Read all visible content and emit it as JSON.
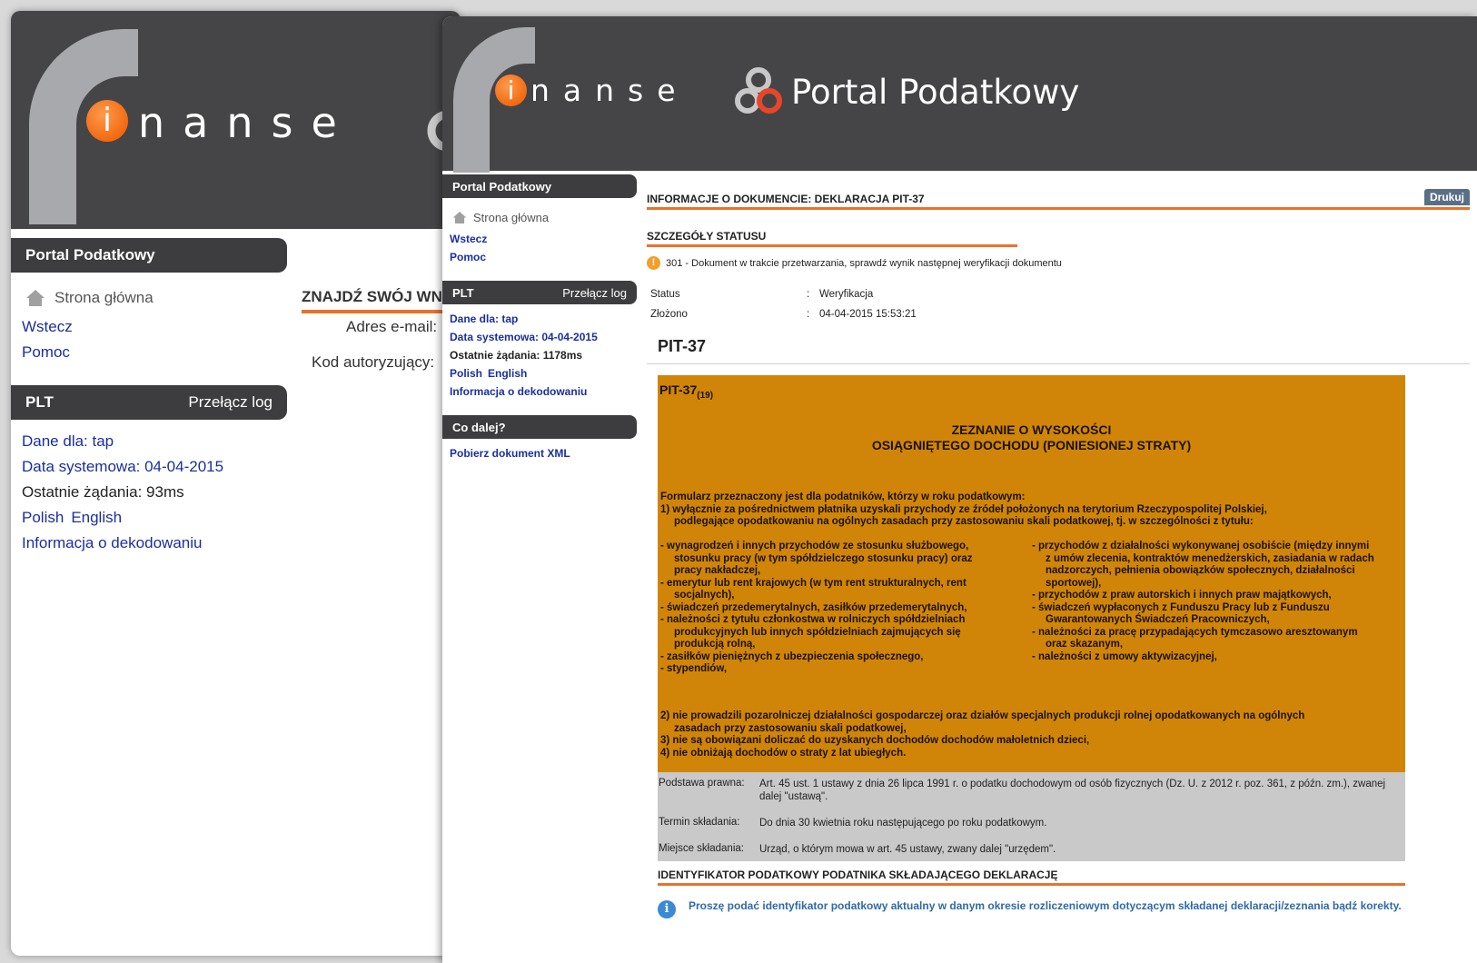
{
  "brand": {
    "logo_i": "i",
    "logo_text": "nanse",
    "portal_title": "Portal Podatkowy"
  },
  "back_window": {
    "sidebar_header": "Portal Podatkowy",
    "home": "Strona główna",
    "links": [
      "Wstecz",
      "Pomoc"
    ],
    "plt_header": "PLT",
    "plt_toggle": "Przełącz log",
    "data_for": "Dane dla: tap",
    "system_date": "Data systemowa: 04-04-2015",
    "last_request": "Ostatnie żądania: 93ms",
    "lang_polish": "Polish",
    "lang_english": "English",
    "decoding_info": "Informacja o dekodowaniu",
    "main_title": "ZNAJDŹ SWÓJ WNIOSEK",
    "email_label": "Adres e-mail:",
    "auth_code_label": "Kod autoryzujący:"
  },
  "sidebar": {
    "header": "Portal Podatkowy",
    "home": "Strona główna",
    "links": [
      "Wstecz",
      "Pomoc"
    ],
    "plt_header": "PLT",
    "plt_toggle": "Przełącz log",
    "data_for": "Dane dla: tap",
    "system_date": "Data systemowa: 04-04-2015",
    "last_request": "Ostatnie żądania: 1178ms",
    "lang_polish": "Polish",
    "lang_english": "English",
    "decoding_info": "Informacja o dekodowaniu",
    "next_header": "Co dalej?",
    "download_xml": "Pobierz dokument XML"
  },
  "document": {
    "info_title": "INFORMACJE O DOKUMENCIE: DEKLARACJA PIT-37",
    "print_label": "Drukuj",
    "status_details_title": "SZCZEGÓŁY STATUSU",
    "status_message": "301 - Dokument w trakcie przetwarzania, sprawdź wynik następnej weryfikacji dokumentu",
    "fields": [
      {
        "key": "Status",
        "sep": ":",
        "value": "Weryfikacja"
      },
      {
        "key": "Złożono",
        "sep": ":",
        "value": "04-04-2015 15:53:21"
      }
    ],
    "form_title": "PIT-37"
  },
  "form": {
    "code": "PIT-37",
    "version": "(19)",
    "title_line1": "ZEZNANIE O WYSOKOŚCI",
    "title_line2": "OSIĄGNIĘTEGO DOCHODU (PONIESIONEJ STRATY)",
    "intro_line1": "Formularz przeznaczony jest dla podatników, którzy w roku podatkowym:",
    "intro_line2": "1) wyłącznie za pośrednictwem płatnika uzyskali przychody ze źródeł położonych na terytorium Rzeczypospolitej Polskiej,",
    "intro_line3": "podlegające opodatkowaniu na ogólnych zasadach przy zastosowaniu skali podatkowej, tj. w szczególności z tytułu:",
    "left_items": [
      {
        "first": "- wynagrodzeń i innych przychodów ze stosunku służbowego,",
        "rest": [
          "stosunku pracy (w tym spółdzielczego stosunku pracy) oraz",
          "pracy nakładczej,"
        ]
      },
      {
        "first": "- emerytur lub rent krajowych (w tym rent strukturalnych, rent",
        "rest": [
          "socjalnych),"
        ]
      },
      {
        "first": "- świadczeń przedemerytalnych, zasiłków przedemerytalnych,",
        "rest": []
      },
      {
        "first": "- należności z tytułu członkostwa w rolniczych spółdzielniach",
        "rest": [
          "produkcyjnych lub innych spółdzielniach zajmujących się",
          "produkcją rolną,"
        ]
      },
      {
        "first": "- zasiłków pieniężnych z ubezpieczenia społecznego,",
        "rest": []
      },
      {
        "first": "- stypendiów,",
        "rest": []
      }
    ],
    "right_items": [
      {
        "first": "- przychodów z działalności wykonywanej osobiście (między innymi",
        "rest": [
          "z umów zlecenia, kontraktów menedżerskich, zasiadania w radach",
          "nadzorczych, pełnienia obowiązków społecznych, działalności",
          "sportowej),"
        ]
      },
      {
        "first": "- przychodów z praw autorskich i innych praw majątkowych,",
        "rest": []
      },
      {
        "first": "- świadczeń wypłaconych z Funduszu Pracy lub z Funduszu",
        "rest": [
          "Gwarantowanych Świadczeń Pracowniczych,"
        ]
      },
      {
        "first": "- należności za pracę przypadających tymczasowo aresztowanym",
        "rest": [
          "oraz skazanym,"
        ]
      },
      {
        "first": "- należności z umowy aktywizacyjnej,",
        "rest": []
      }
    ],
    "tail_line1": "2) nie prowadzili pozarolniczej działalności gospodarczej oraz działów specjalnych produkcji rolnej opodatkowanych na ogólnych",
    "tail_line2": "zasadach przy zastosowaniu skali podatkowej,",
    "tail_line3": "3) nie są obowiązani doliczać do uzyskanych dochodów dochodów małoletnich dzieci,",
    "tail_line4": "4) nie obniżają dochodów o straty z lat ubiegłych."
  },
  "legal": [
    {
      "key": "Podstawa prawna:",
      "value": "Art. 45 ust. 1 ustawy z dnia 26 lipca 1991 r. o podatku dochodowym od osób fizycznych (Dz. U. z 2012 r. poz. 361, z późn. zm.), zwanej dalej \"ustawą\"."
    },
    {
      "key": "Termin składania:",
      "value": "Do dnia 30 kwietnia roku następującego po roku podatkowym."
    },
    {
      "key": "Miejsce składania:",
      "value": "Urząd, o którym mowa w art. 45 ustawy, zwany dalej \"urzędem\"."
    }
  ],
  "identifier": {
    "title": "IDENTYFIKATOR PODATKOWY PODATNIKA SKŁADAJĄCEGO DEKLARACJĘ",
    "info_message": "Proszę podać identyfikator podatkowy aktualny w danym okresie rozliczeniowym dotyczącym składanej deklaracji/zeznania bądź korekty."
  },
  "colors": {
    "banner": "#454547",
    "accent": "#e8722a",
    "link": "#1a2fa0",
    "form_box": "#d08508"
  }
}
